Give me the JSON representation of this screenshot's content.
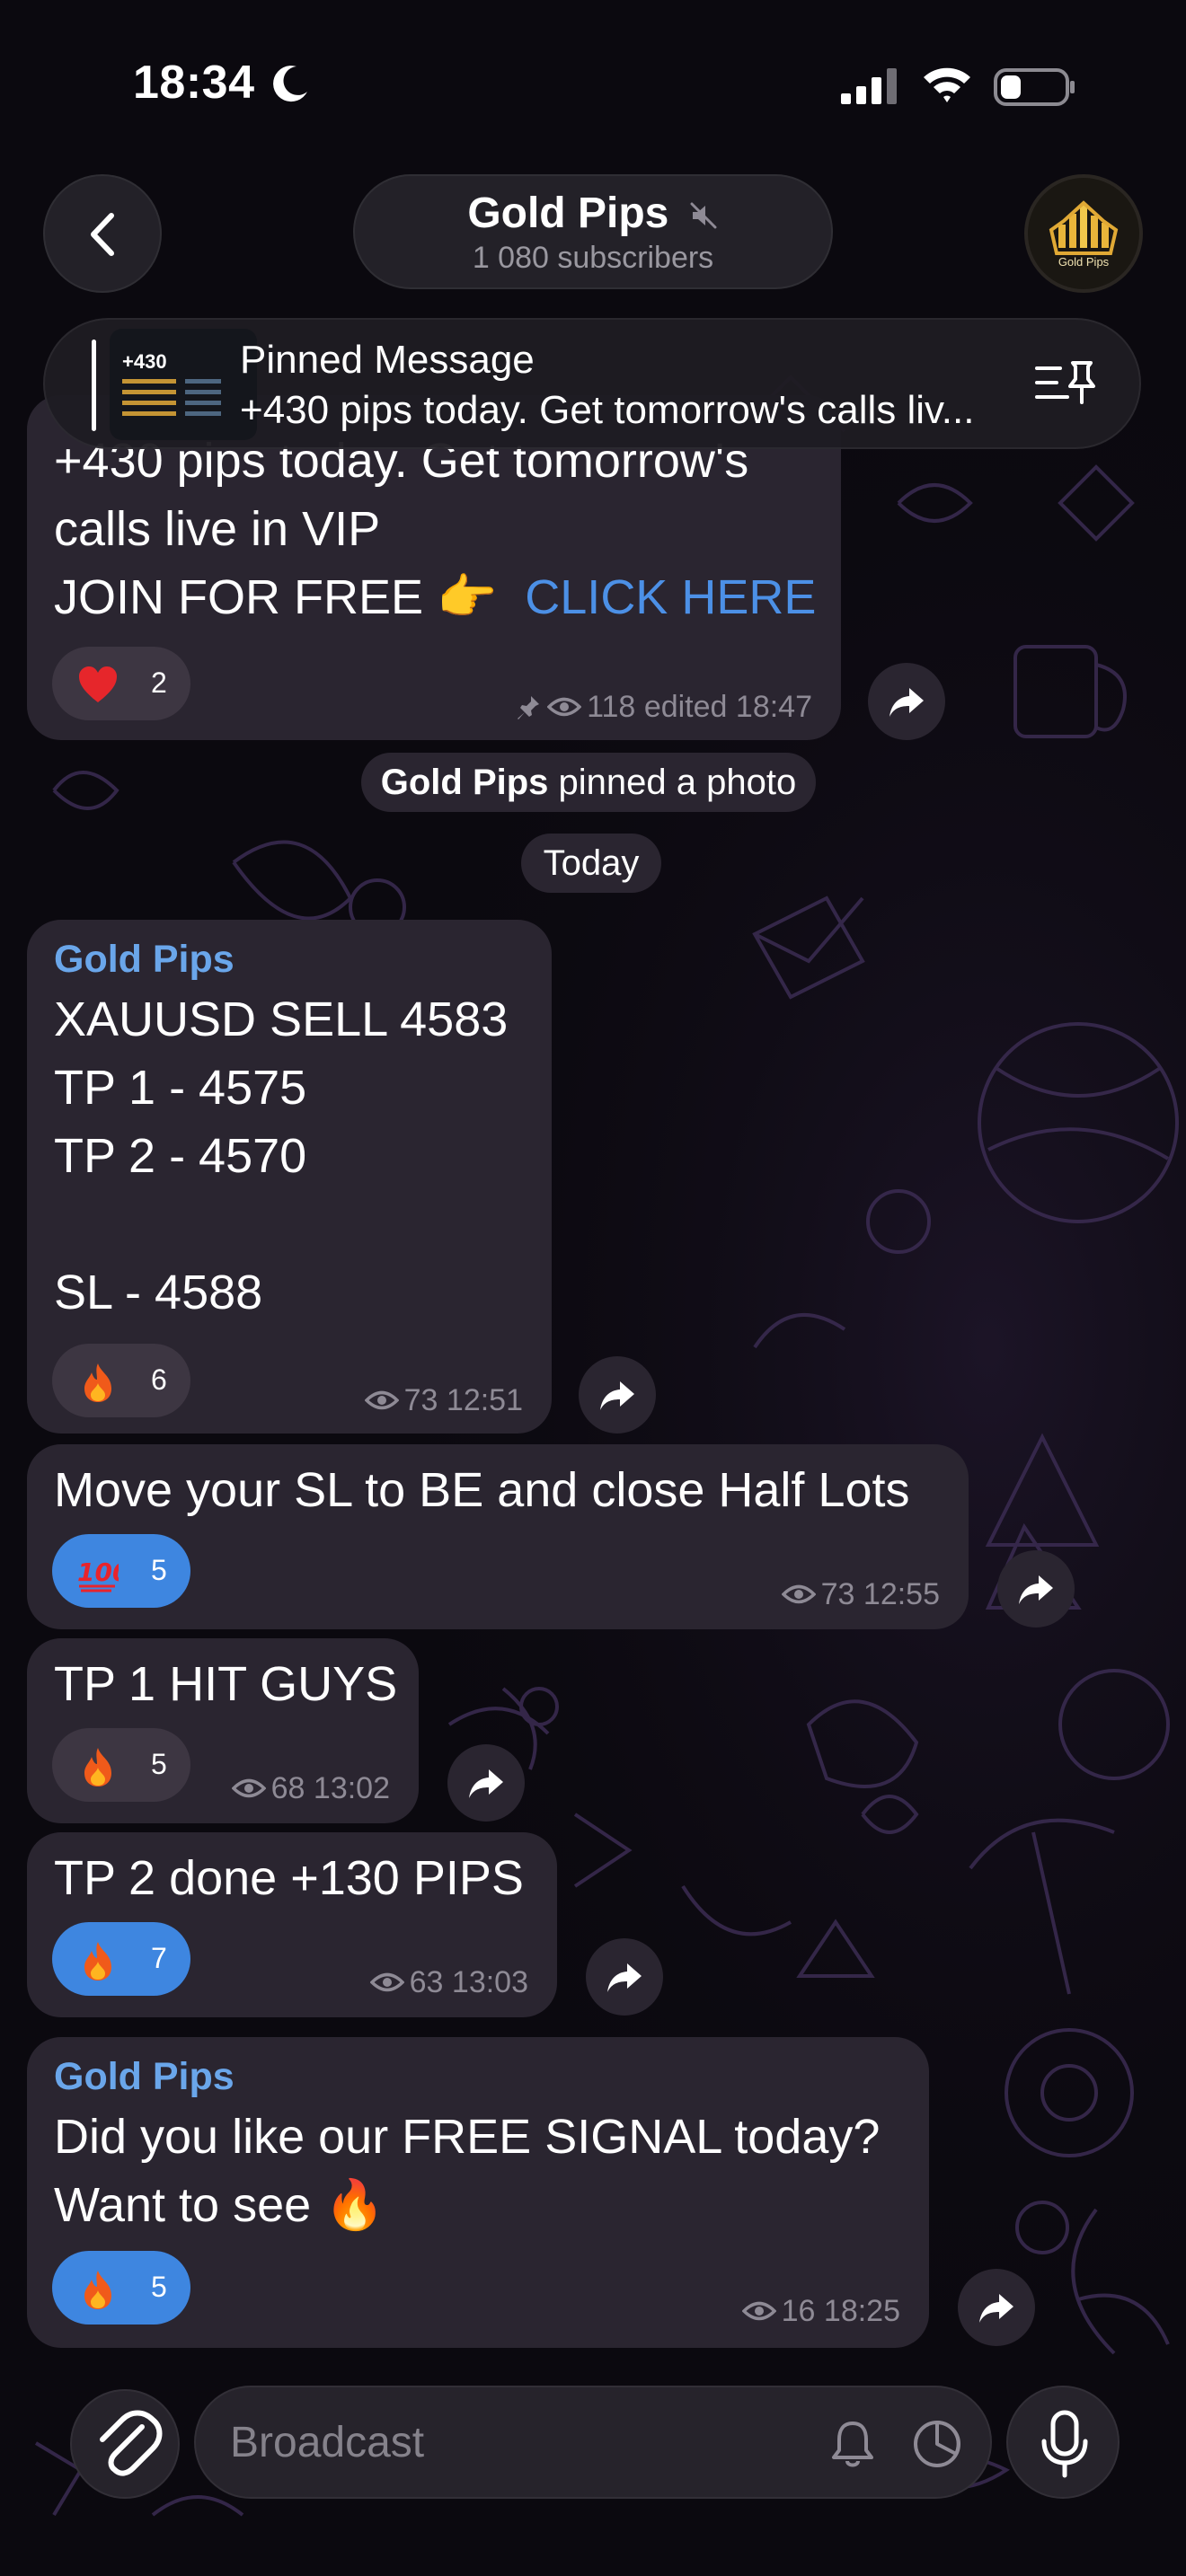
{
  "status_bar": {
    "time": "18:34"
  },
  "header": {
    "channel_name": "Gold Pips",
    "subscribers": "1 080 subscribers",
    "avatar_text": "Gold Pips"
  },
  "pinned": {
    "title": "Pinned Message",
    "text": "+430 pips today. Get tomorrow's calls liv...",
    "thumb_text": "+430"
  },
  "messages": [
    {
      "lines": [
        "+430 pips today. Get tomorrow's",
        "calls live in VIP"
      ],
      "join_text": "JOIN FOR FREE 👉",
      "link_text": "CLICK HERE",
      "reaction": {
        "emoji": "heart",
        "count": "2",
        "active": false
      },
      "views": "118",
      "edited": "edited",
      "time": "18:47"
    },
    {
      "author": "Gold Pips",
      "lines": [
        "XAUUSD SELL 4583",
        "TP 1 - 4575",
        "TP 2 - 4570",
        "SL - 4588"
      ],
      "reaction": {
        "emoji": "fire",
        "count": "6",
        "active": false
      },
      "views": "73",
      "time": "12:51"
    },
    {
      "lines": [
        "Move your SL to BE and close Half Lots"
      ],
      "reaction": {
        "emoji": "hundred",
        "count": "5",
        "active": true
      },
      "views": "73",
      "time": "12:55"
    },
    {
      "lines": [
        "TP 1 HIT GUYS"
      ],
      "reaction": {
        "emoji": "fire",
        "count": "5",
        "active": false
      },
      "views": "68",
      "time": "13:02"
    },
    {
      "lines": [
        "TP 2 done +130 PIPS"
      ],
      "reaction": {
        "emoji": "fire",
        "count": "7",
        "active": true
      },
      "views": "63",
      "time": "13:03"
    },
    {
      "author": "Gold Pips",
      "lines": [
        "Did you like our FREE SIGNAL today?",
        "Want to see 🔥"
      ],
      "reaction": {
        "emoji": "fire",
        "count": "5",
        "active": true
      },
      "views": "16",
      "time": "18:25"
    }
  ],
  "service": {
    "pinned_actor": "Gold Pips",
    "pinned_action": " pinned a photo",
    "date_label": "Today"
  },
  "input": {
    "placeholder": "Broadcast"
  },
  "colors": {
    "accent": "#3e86e0",
    "link": "#4c90e6",
    "author": "#6aa6ea",
    "bubble": "#2a2530"
  }
}
